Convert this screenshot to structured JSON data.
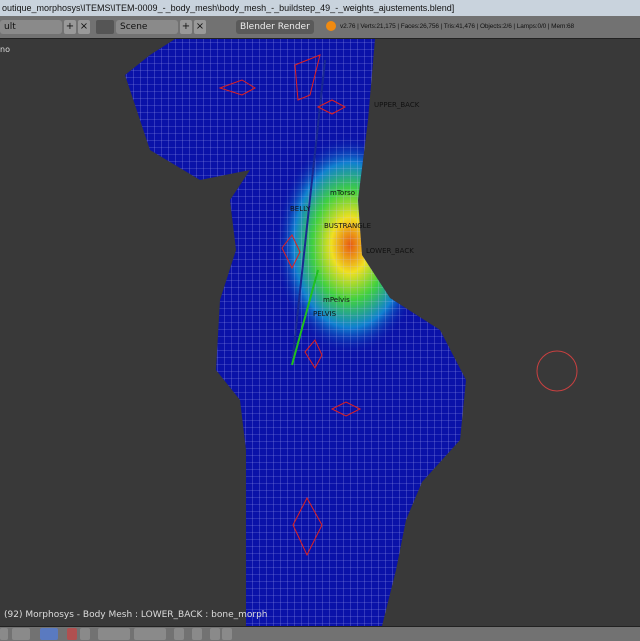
{
  "window": {
    "title": "outique_morphosys\\ITEMS\\ITEM-0009_-_body_mesh\\body_mesh_-_buildstep_49_-_weights_ajustements.blend]"
  },
  "header": {
    "layout_value": "ult",
    "scene_value": "Scene",
    "render_engine": "Blender Render",
    "stats": "v2.76 | Verts:21,175 | Faces:26,756 | Tris:41,476 | Objects:2/6 | Lamps:0/0 | Mem:68"
  },
  "viewport": {
    "corner_text": "no",
    "bone_labels": {
      "upper_back": "UPPER_BACK",
      "mtorso": "mTorso",
      "belly": "BELLY",
      "lower_back": "LOWER_BACK",
      "overlap": "BUSTRANGLE",
      "pelvis": "mPelvis",
      "pelvis2": "PELVIS"
    },
    "status": "(92) Morphosys - Body Mesh : LOWER_BACK : bone_morph",
    "colors": {
      "mesh": "#0a12a8",
      "wire": "#c8c8ff",
      "bone": "#e02020",
      "heat_peak": "#e85a10",
      "background": "#393939"
    }
  }
}
